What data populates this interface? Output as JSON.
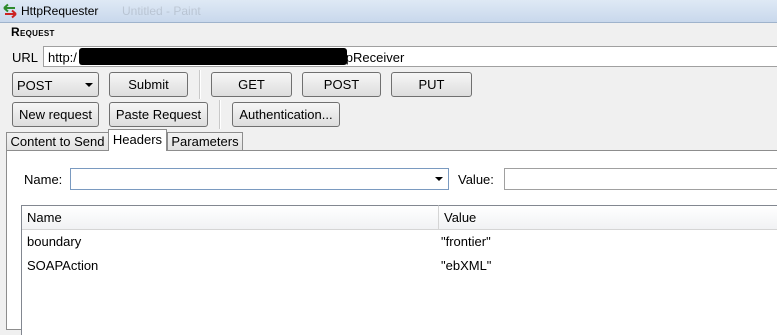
{
  "window": {
    "title": "HttpRequester",
    "background_title": "Untitled - Paint"
  },
  "request": {
    "section_title": "Request",
    "url_label": "URL",
    "url_prefix": "http:/",
    "url_suffix": "b2b/httpReceiver"
  },
  "toolbar": {
    "method_select": "POST",
    "submit_label": "Submit",
    "get_label": "GET",
    "post_label": "POST",
    "put_label": "PUT",
    "new_request_label": "New request",
    "paste_request_label": "Paste Request",
    "authentication_label": "Authentication..."
  },
  "tabs": [
    {
      "label": "Content to Send",
      "active": false
    },
    {
      "label": "Headers",
      "active": true
    },
    {
      "label": "Parameters",
      "active": false
    }
  ],
  "headers_form": {
    "name_label": "Name:",
    "name_value": "",
    "value_label": "Value:",
    "value_value": ""
  },
  "headers_table": {
    "columns": [
      "Name",
      "Value"
    ],
    "rows": [
      {
        "name": "boundary",
        "value": "\"frontier\""
      },
      {
        "name": "SOAPAction",
        "value": "\"ebXML\""
      }
    ]
  },
  "colors": {
    "window_bg": "#f0f0f0",
    "panel_bg": "#ffffff",
    "titlebar_bg": "#dfe9f5",
    "redaction": "#000000"
  }
}
